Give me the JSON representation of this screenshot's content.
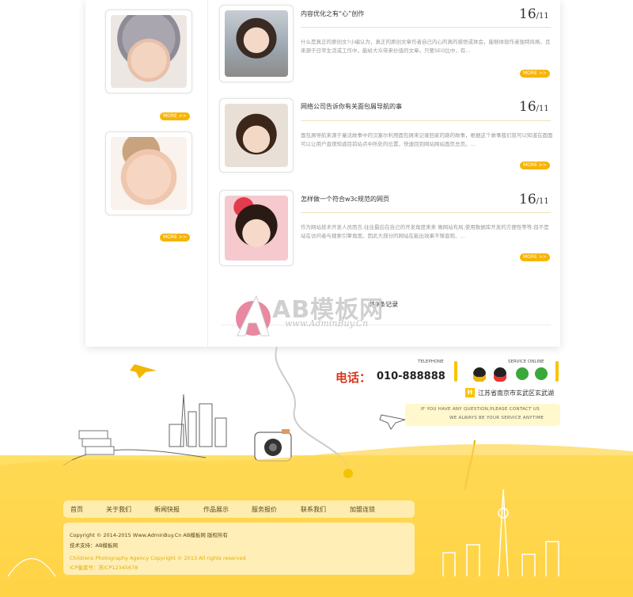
{
  "left_column": {
    "more_labels": [
      "MORE >>",
      "MORE >>"
    ]
  },
  "articles": [
    {
      "title": "内容优化之有“心”创作",
      "day": "16",
      "month": "/11",
      "desc": "什么是真正的原创文?小编认为，真正的原创文章作者自己内心的真的感悟或体会，能够体现作者独特风格，且来源于日常生活或工作中，能给大众带来价值的文章。只要SEO比中，有…",
      "more": "MORE >>"
    },
    {
      "title": "网络公司告诉你有关面包屑导航的事",
      "day": "16",
      "month": "/11",
      "desc": "面包屑导航来源于童话故事中的汉塞尔利用面包屑来记录回家的路的故事，根据这个故事我们就可以知道在面面可以让用户直观知道目前站点中所处的位置，快速回到网站网站面页总页。…",
      "more": "MORE >>"
    },
    {
      "title": "怎样做一个符合w3c规范的网页",
      "day": "16",
      "month": "/11",
      "desc": "作为网站技术开发人员而言,往往最后在自己的开发角度来来 做网站布局,使用数据库开发的方便性等等,但不是站在访问者与搜索引擎角度。因此大部分的网站在能出效果不够直观、…",
      "more": "MORE >>"
    }
  ],
  "list_footer_text": "共9条记录",
  "watermark": {
    "brand": "AB模板网",
    "url": "www.AdminBuy.Cn"
  },
  "contact": {
    "telephone_label": "TELEPHONE",
    "phone_prefix": "电话：",
    "phone_number": "010-888888",
    "service_label": "SERVICE ONLINE",
    "address_badge": "H",
    "address": "江苏省南京市玄武区玄武湖",
    "msg_line1": "IF YOU HAVE ANY QUESTION,PLEASE CONTACT US",
    "msg_line2": "WE ALWAYS BE YOUR SERVICE ANYTIME"
  },
  "footer_nav": [
    "首页",
    "关于我们",
    "新闻快报",
    "作品展示",
    "服务报价",
    "联系我们",
    "加盟连锁"
  ],
  "copyright": {
    "line1": "Copyright © 2014-2015 Www.AdminBuy.Cn AB模板网 版权所有",
    "line2": "技术支持：AB模板网",
    "line3": "Childrens Photography Agency Copyright © 2013 All rights reserved",
    "line4": "ICP备案号：苏ICP12345678"
  },
  "colors": {
    "accent_yellow": "#f7b400",
    "phone_red": "#d9381e",
    "footer_yellow": "#ffcc33"
  }
}
